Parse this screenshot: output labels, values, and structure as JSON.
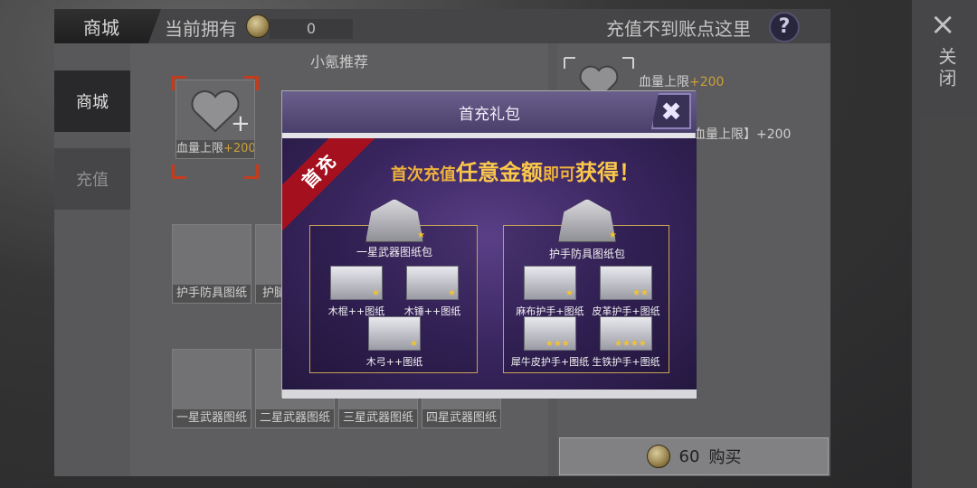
{
  "shop": {
    "title": "商城",
    "own_label": "当前拥有",
    "coin_balance": "0",
    "recharge_link": "充值不到账点这里",
    "help_icon": "?",
    "sidebar": [
      {
        "label": "商城",
        "active": true
      },
      {
        "label": "充值",
        "active": false
      }
    ],
    "recommend_title": "小氪推荐",
    "featured_item": {
      "label": "血量上限",
      "bonus": "+200"
    },
    "row2_items": [
      "护手防具图纸",
      "护腿"
    ],
    "row3_items": [
      "一星武器图纸",
      "二星武器图纸",
      "三星武器图纸",
      "四星武器图纸"
    ]
  },
  "detail": {
    "name": "血量上限",
    "bonus": "+200",
    "desc": "血量上限】+200",
    "buy_price": "60",
    "buy_label": "购买"
  },
  "close_panel": {
    "icon": "×",
    "label": "关闭"
  },
  "modal": {
    "title": "首充礼包",
    "close_icon": "✖",
    "ribbon": "首充",
    "headline_pre": "首次充值",
    "headline_big1": "任意金额",
    "headline_mid": "即可",
    "headline_big2": "获得！",
    "packs": [
      {
        "name": "一星武器图纸包",
        "stars": "★",
        "items": [
          {
            "label": "木棍++图纸",
            "stars": "★"
          },
          {
            "label": "木锤++图纸",
            "stars": "★"
          },
          {
            "label": "木弓++图纸",
            "stars": "★"
          }
        ]
      },
      {
        "name": "护手防具图纸包",
        "stars": "★",
        "items": [
          {
            "label": "麻布护手+图纸",
            "stars": "★"
          },
          {
            "label": "皮革护手+图纸",
            "stars": "★★"
          },
          {
            "label": "犀牛皮护手+图纸",
            "stars": "★★★"
          },
          {
            "label": "生铁护手+图纸",
            "stars": "★★★★"
          }
        ]
      }
    ]
  },
  "colors": {
    "accent_gold": "#f0b23c",
    "ribbon_red": "#a5101f",
    "modal_purple": "#3a2660",
    "selection_red": "#d2401f"
  }
}
